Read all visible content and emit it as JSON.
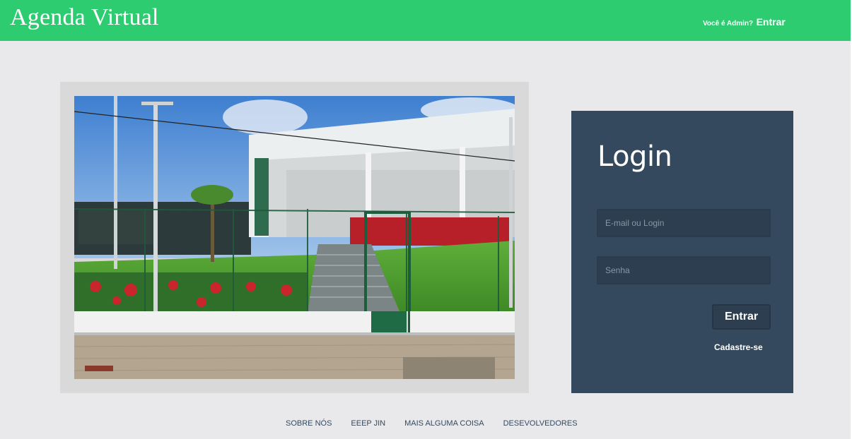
{
  "header": {
    "brand": "Agenda Virtual",
    "admin_question": "Você é Admin?",
    "admin_login": "Entrar",
    "bg_color": "#2ecc71"
  },
  "login": {
    "title": "Login",
    "email_placeholder": "E-mail ou Login",
    "password_placeholder": "Senha",
    "submit_label": "Entrar",
    "signup_label": "Cadastre-se",
    "panel_color": "#34495e"
  },
  "footer": {
    "links": [
      "SOBRE NÓS",
      "EEEP JIN",
      "MAIS ALGUMA COISA",
      "DESEVOLVEDORES"
    ]
  }
}
